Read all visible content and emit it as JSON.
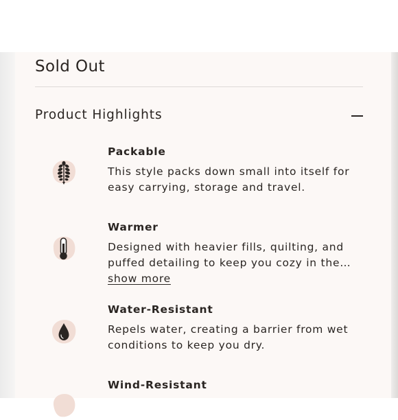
{
  "product": {
    "status": "Sold Out"
  },
  "highlights_section": {
    "title": "Product Highlights",
    "toggle_icon": "minus-icon",
    "items": [
      {
        "title": "Packable",
        "description": "This style packs down small into itself for easy carrying, storage and travel.",
        "icon": "leaf-icon"
      },
      {
        "title": "Warmer",
        "description": "Designed with heavier fills, quilting, and puffed detailing to keep you cozy in the…",
        "show_more": "show more",
        "icon": "thermometer-icon"
      },
      {
        "title": "Water-Resistant",
        "description": "Repels water, creating a barrier from wet conditions to keep you dry.",
        "icon": "water-drop-icon"
      },
      {
        "title": "Wind-Resistant",
        "icon": "wind-icon"
      }
    ]
  },
  "colors": {
    "panel_background": "#fcf8f6",
    "icon_blob": "#f1ddd5",
    "text": "#2a2522"
  }
}
